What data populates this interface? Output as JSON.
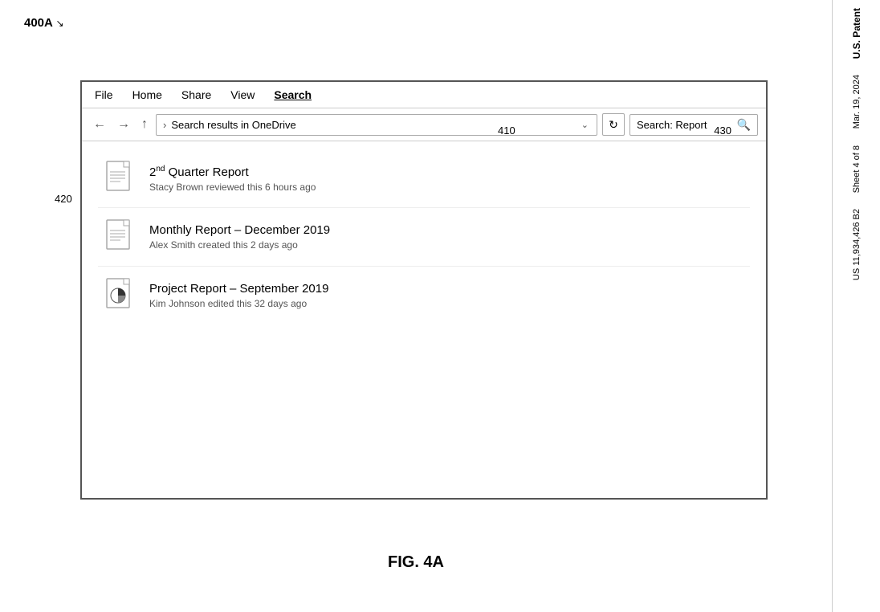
{
  "figure": {
    "label": "400A",
    "caption": "FIG. 4A",
    "arrow": "↘"
  },
  "annotations": {
    "label_410": "410",
    "label_420": "420",
    "label_430": "430"
  },
  "menu": {
    "items": [
      {
        "label": "File",
        "active": false
      },
      {
        "label": "Home",
        "active": false
      },
      {
        "label": "Share",
        "active": false
      },
      {
        "label": "View",
        "active": false
      },
      {
        "label": "Search",
        "active": true
      }
    ]
  },
  "toolbar": {
    "back_label": "←",
    "forward_label": "→",
    "up_label": "↑",
    "address_chevron": "›",
    "address_text": "Search results in OneDrive",
    "dropdown_symbol": "⌄",
    "refresh_symbol": "↻",
    "search_value": "Search: Report",
    "search_icon": "🔍"
  },
  "files": [
    {
      "title": "2nd Quarter Report",
      "superscript": "nd",
      "base": "2",
      "title_rest": " Quarter Report",
      "subtitle": "Stacy Brown reviewed this 6 hours ago",
      "icon_type": "plain"
    },
    {
      "title": "Monthly Report – December 2019",
      "subtitle": "Alex Smith created this 2 days ago",
      "icon_type": "plain"
    },
    {
      "title": "Project Report – September 2019",
      "subtitle": "Kim Johnson edited this 32 days ago",
      "icon_type": "chart"
    }
  ],
  "patent": {
    "line1": "U.S. Patent",
    "line2": "Mar. 19, 2024",
    "line3": "Sheet 4 of 8",
    "line4": "US 11,934,426 B2"
  }
}
